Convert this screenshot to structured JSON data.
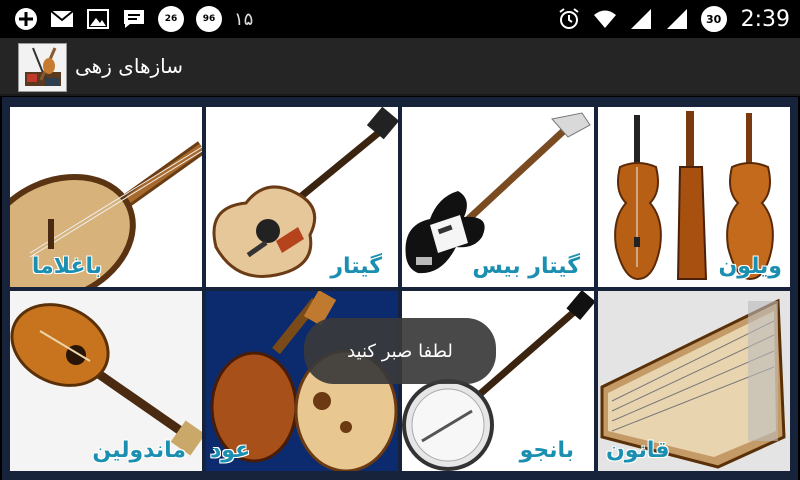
{
  "status_bar": {
    "left_number": "۱۵",
    "badge_1": "26",
    "badge_2": "96",
    "battery": "30",
    "time": "2:39",
    "icons": [
      "add-icon",
      "email-icon",
      "image-icon",
      "chat-icon",
      "badge-icon",
      "badge-icon",
      "alarm-icon",
      "wifi-icon",
      "signal-icon",
      "signal-icon",
      "battery-icon"
    ]
  },
  "action_bar": {
    "title": "سازهای زهی",
    "icon": "app-logo-icon"
  },
  "grid": {
    "items": [
      {
        "label": "باغلاما",
        "icon": "baglama-icon"
      },
      {
        "label": "گیتار",
        "icon": "guitar-icon"
      },
      {
        "label": "گیتار بیس",
        "icon": "bass-guitar-icon"
      },
      {
        "label": "ویلون",
        "icon": "violin-icon"
      },
      {
        "label": "ماندولین",
        "icon": "mandolin-icon"
      },
      {
        "label": "عود",
        "icon": "oud-icon"
      },
      {
        "label": "بانجو",
        "icon": "banjo-icon"
      },
      {
        "label": "قانون",
        "icon": "qanun-icon"
      }
    ]
  },
  "toast": {
    "message": "لطفا صبر کنید"
  },
  "colors": {
    "label": "#1b8fb0",
    "grid_background": "#16233a",
    "action_bar": "#252525"
  }
}
